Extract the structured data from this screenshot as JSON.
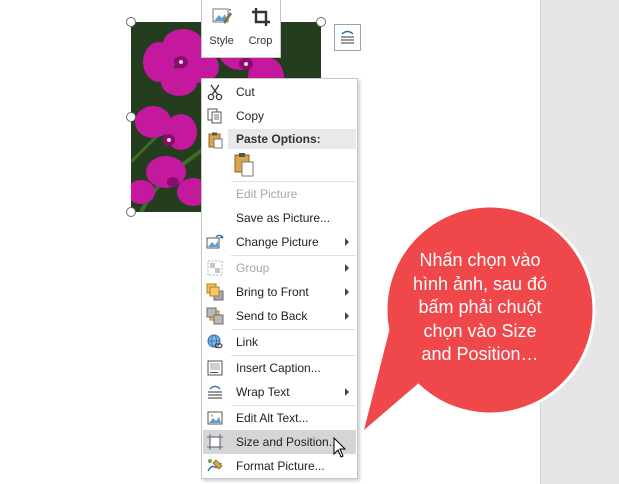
{
  "mini_toolbar": {
    "style_label": "Style",
    "crop_label": "Crop"
  },
  "context_menu": {
    "items": [
      {
        "id": "cut",
        "label": "Cut",
        "enabled": true
      },
      {
        "id": "copy",
        "label": "Copy",
        "enabled": true
      },
      {
        "id": "paste-options",
        "label": "Paste Options:",
        "enabled": true
      },
      {
        "id": "edit-picture",
        "label": "Edit Picture",
        "enabled": false
      },
      {
        "id": "save-as-picture",
        "label": "Save as Picture...",
        "enabled": true
      },
      {
        "id": "change-picture",
        "label": "Change Picture",
        "enabled": true,
        "submenu": true
      },
      {
        "id": "group",
        "label": "Group",
        "enabled": false,
        "submenu": true
      },
      {
        "id": "bring-to-front",
        "label": "Bring to Front",
        "enabled": true,
        "submenu": true
      },
      {
        "id": "send-to-back",
        "label": "Send to Back",
        "enabled": true,
        "submenu": true
      },
      {
        "id": "link",
        "label": "Link",
        "enabled": true
      },
      {
        "id": "insert-caption",
        "label": "Insert Caption...",
        "enabled": true
      },
      {
        "id": "wrap-text",
        "label": "Wrap Text",
        "enabled": true,
        "submenu": true
      },
      {
        "id": "edit-alt-text",
        "label": "Edit Alt Text...",
        "enabled": true
      },
      {
        "id": "size-and-position",
        "label": "Size and Position...",
        "enabled": true,
        "highlighted": true
      },
      {
        "id": "format-picture",
        "label": "Format Picture...",
        "enabled": true
      }
    ]
  },
  "callout": {
    "lines": [
      "Nhấn chọn vào",
      "hình ảnh, sau đó",
      "bấm phải chuột",
      "chọn vào Size",
      "and Position…"
    ],
    "color": "#f0474a"
  },
  "colors": {
    "highlight": "#d5d5d5",
    "disabled_text": "#a6a6a6",
    "orchid": "#c2189d"
  }
}
